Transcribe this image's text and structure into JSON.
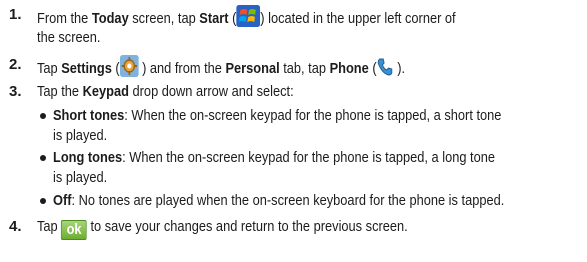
{
  "steps": [
    {
      "number": "1.",
      "pre": "From the ",
      "bold1": "Today",
      "mid1": " screen, tap ",
      "bold2": "Start",
      "open": " (",
      "close": ") located in the upper left corner of",
      "line2": "the screen.",
      "icon": "windows-start-icon"
    },
    {
      "number": "2.",
      "pre": "Tap ",
      "bold1": "Settings",
      "open1": " (",
      "close1": " ) and from the ",
      "bold2": "Personal",
      "mid": " tab, tap ",
      "bold3": "Phone",
      "open2": " (",
      "close2": " ).",
      "icon1": "settings-icon",
      "icon2": "phone-handset-icon"
    },
    {
      "number": "3.",
      "pre": "Tap the ",
      "bold1": "Keypad",
      "post": " drop down arrow and select:"
    },
    {
      "number": "4.",
      "pre": "Tap ",
      "button": "ok",
      "post": " to save your changes and return to the previous screen."
    }
  ],
  "options": [
    {
      "term": "Short tones",
      "line1": ": When the on-screen keypad for the phone is tapped, a short tone",
      "line2": "is played."
    },
    {
      "term": "Long tones",
      "line1": ": When the on-screen keypad for the phone is tapped, a long tone",
      "line2": "is played."
    },
    {
      "term": "Off",
      "line1": ": No tones are played when the on-screen keyboard for the phone is tapped."
    }
  ]
}
